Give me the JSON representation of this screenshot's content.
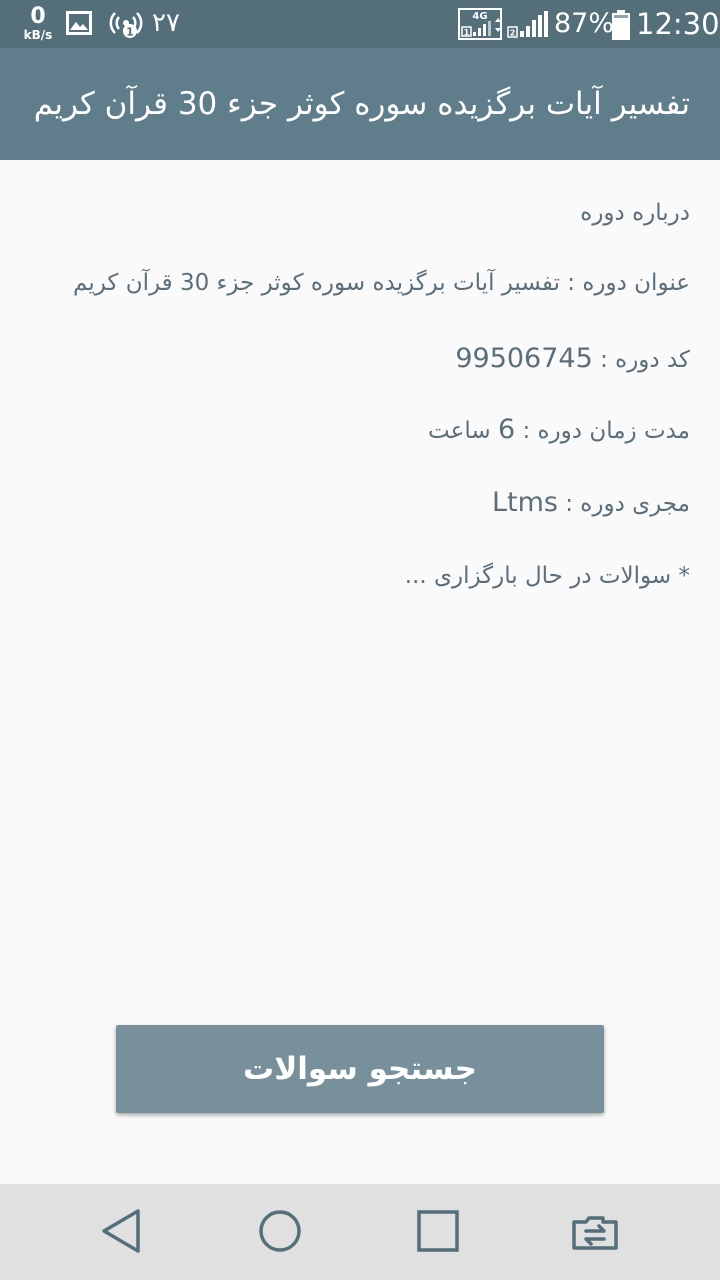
{
  "status_bar": {
    "speed_value": "0",
    "speed_unit": "kB/s",
    "date": "۲۷",
    "network_label": "4G",
    "sim1": "1",
    "sim2": "2",
    "battery_percent": "87%",
    "time": "12:30",
    "icons": [
      "gallery-icon",
      "hotspot-icon",
      "signal-4g-icon",
      "signal-sim2-icon",
      "battery-icon"
    ]
  },
  "app_bar": {
    "title": "تفسیر آیات برگزیده سوره کوثر جزء 30 قرآن کریم"
  },
  "course": {
    "about_label": "درباره دوره",
    "title_label": "عنوان دوره :",
    "title_value": "تفسیر آیات برگزیده سوره کوثر جزء 30 قرآن کریم",
    "code_label": "کد دوره :",
    "code_value": "99506745",
    "duration_label": "مدت زمان دوره :",
    "duration_value": "6",
    "duration_unit": "ساعت",
    "instructor_label": "مجری دوره :",
    "instructor_value": "Ltms",
    "questions_note": "* سوالات در حال بارگزاری ..."
  },
  "actions": {
    "search_questions_label": "جستجو سوالات"
  },
  "nav_bar": {
    "icons": [
      "back-icon",
      "home-icon",
      "recents-icon",
      "switch-sim-icon"
    ]
  },
  "colors": {
    "status_bar": "#546e7a",
    "app_bar": "#607d8b",
    "button": "#78909c",
    "text": "#5b6f7b",
    "background": "#fafafa",
    "nav_bar": "#e0e0e0"
  }
}
